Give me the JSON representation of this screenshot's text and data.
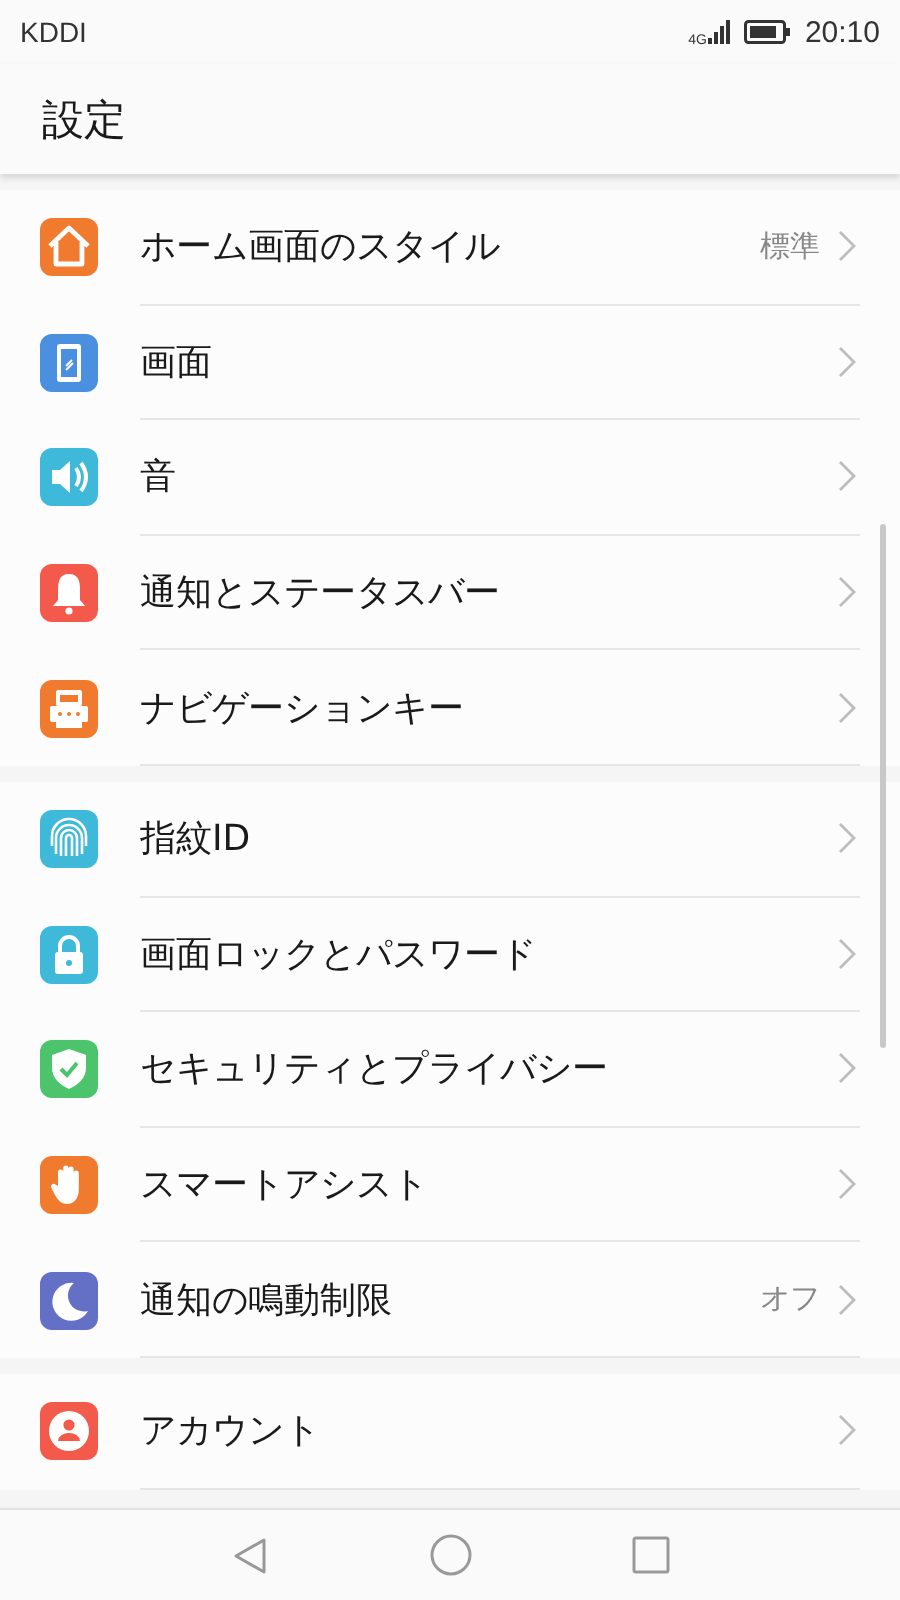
{
  "status_bar": {
    "carrier": "KDDI",
    "network": "4G",
    "time": "20:10"
  },
  "header": {
    "title": "設定"
  },
  "groups": [
    {
      "items": [
        {
          "label": "ホーム画面のスタイル",
          "value": "標準",
          "kind": "home",
          "color": "#f07b2f"
        },
        {
          "label": "画面",
          "kind": "display",
          "color": "#4a8fe0"
        },
        {
          "label": "音",
          "kind": "sound",
          "color": "#3fb9d9"
        },
        {
          "label": "通知とステータスバー",
          "kind": "bell",
          "color": "#f45a4c"
        },
        {
          "label": "ナビゲーションキー",
          "kind": "navkey",
          "color": "#f07b2f"
        }
      ]
    },
    {
      "items": [
        {
          "label": "指紋ID",
          "kind": "fingerprint",
          "color": "#3fb9d9"
        },
        {
          "label": "画面ロックとパスワード",
          "kind": "lock",
          "color": "#3fb9d9"
        },
        {
          "label": "セキュリティとプライバシー",
          "kind": "shield",
          "color": "#4cc46b"
        },
        {
          "label": "スマートアシスト",
          "kind": "hand",
          "color": "#f07b2f"
        },
        {
          "label": "通知の鳴動制限",
          "value": "オフ",
          "kind": "moon",
          "color": "#6470c6"
        }
      ]
    },
    {
      "items": [
        {
          "label": "アカウント",
          "kind": "account",
          "color": "#f45a4c"
        }
      ]
    }
  ]
}
